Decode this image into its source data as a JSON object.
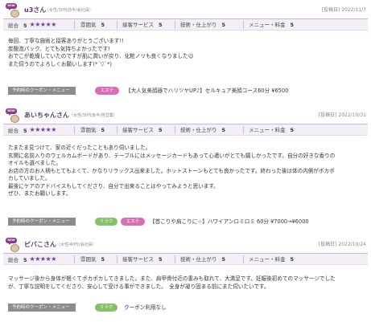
{
  "reviews": [
    {
      "name": "u3さん",
      "meta": "（女性/30代前半/会社員）",
      "date": "[投稿日] 2022/11/7",
      "ratings": {
        "overall_label": "総合",
        "overall_value": "5",
        "stars": "★★★★★",
        "atmosphere_label": "雰囲気",
        "atmosphere_value": "5",
        "service_label": "接客サービス",
        "service_value": "5",
        "tech_label": "技術・仕上がり",
        "tech_value": "5",
        "menu_label": "メニュー・料金",
        "menu_value": "5"
      },
      "body": [
        "毎回、丁寧な施術と接客ありがとうございます!!",
        "炭酸泡パック、とても気持ちよかったです!",
        "おでこが乾燥していたのですが肌に潤いが戻り、化粧ノリも良くなりました☺",
        "また伺うのでよろしくお願いします(*´▽`*)"
      ],
      "coupon_label": "予約時のクーポン・メニュー",
      "tags": [
        "エステ"
      ],
      "coupon_text": "【大人気美顔器でハリツヤUP♪】セルキュア美顔コース60分 ¥6500"
    },
    {
      "name": "あいちゃんさん",
      "meta": "（女性/30代後半/自営業）",
      "date": "[投稿日] 2022/10/31",
      "ratings": {
        "overall_label": "総合",
        "overall_value": "5",
        "stars": "★★★★★",
        "atmosphere_label": "雰囲気",
        "atmosphere_value": "5",
        "service_label": "接客サービス",
        "service_value": "5",
        "tech_label": "技術・仕上がり",
        "tech_value": "5",
        "menu_label": "メニュー・料金",
        "menu_value": "5"
      },
      "body": [
        "たまたま見つけて、家の近くだったこともあり伺いました。",
        "玄関に名前入りのウェルカムボードがあり、テーブルにはメッセージカードもあって心遣いがとても嬉しかったです。自分の好きな香りの",
        "オイルも選べました。",
        "お店の方のお人柄もとてもよくて、かなりリラックス出来ました。ホットストーンもとても良かったです。終わった後は体の内側がポカポ",
        "カしていました。",
        "最後にケアのアドバイスもしてくださり、自分で出来ることはやってみようと思います。",
        "ぜひ、またお願いします。"
      ],
      "coupon_label": "予約時のクーポン・メニュー",
      "tags": [
        "リラク",
        "エステ"
      ],
      "coupon_text": "【首こりや肩こりに☆】ハワイアンロミロミ 60分 ¥7000→¥6000"
    },
    {
      "name": "ピバこさん",
      "meta": "（女性/40代/会社員）",
      "date": "[投稿日] 2022/10/24",
      "ratings": {
        "overall_label": "総合",
        "overall_value": "5",
        "stars": "★★★★★",
        "atmosphere_label": "雰囲気",
        "atmosphere_value": "5",
        "service_label": "接客サービス",
        "service_value": "5",
        "tech_label": "技術・仕上がり",
        "tech_value": "5",
        "menu_label": "メニュー・料金",
        "menu_value": "5"
      },
      "body": [
        "マッサージ後から身体が軽くてポカポカしてきました。また、肩甲骨付近の重みも取れて、大満足です。妊娠後初めてのマッサージでした",
        "が、丁寧な説明をしてくださり、安心して受ける事ができました。　全身が凝り固まる前にまた伺いたいです。"
      ],
      "coupon_label": "予約時のクーポン・メニュー",
      "tags": [
        "リラク"
      ],
      "coupon_text": "クーポン利用なし"
    }
  ],
  "avatar_badge": "NEW",
  "colors": {
    "accent": "#7a3d8f",
    "rating_bg": "#f4eff6",
    "tag_esthe": "#d86fb4",
    "tag_relax": "#86c167",
    "coupon_label_bg": "#8c8c8c"
  }
}
